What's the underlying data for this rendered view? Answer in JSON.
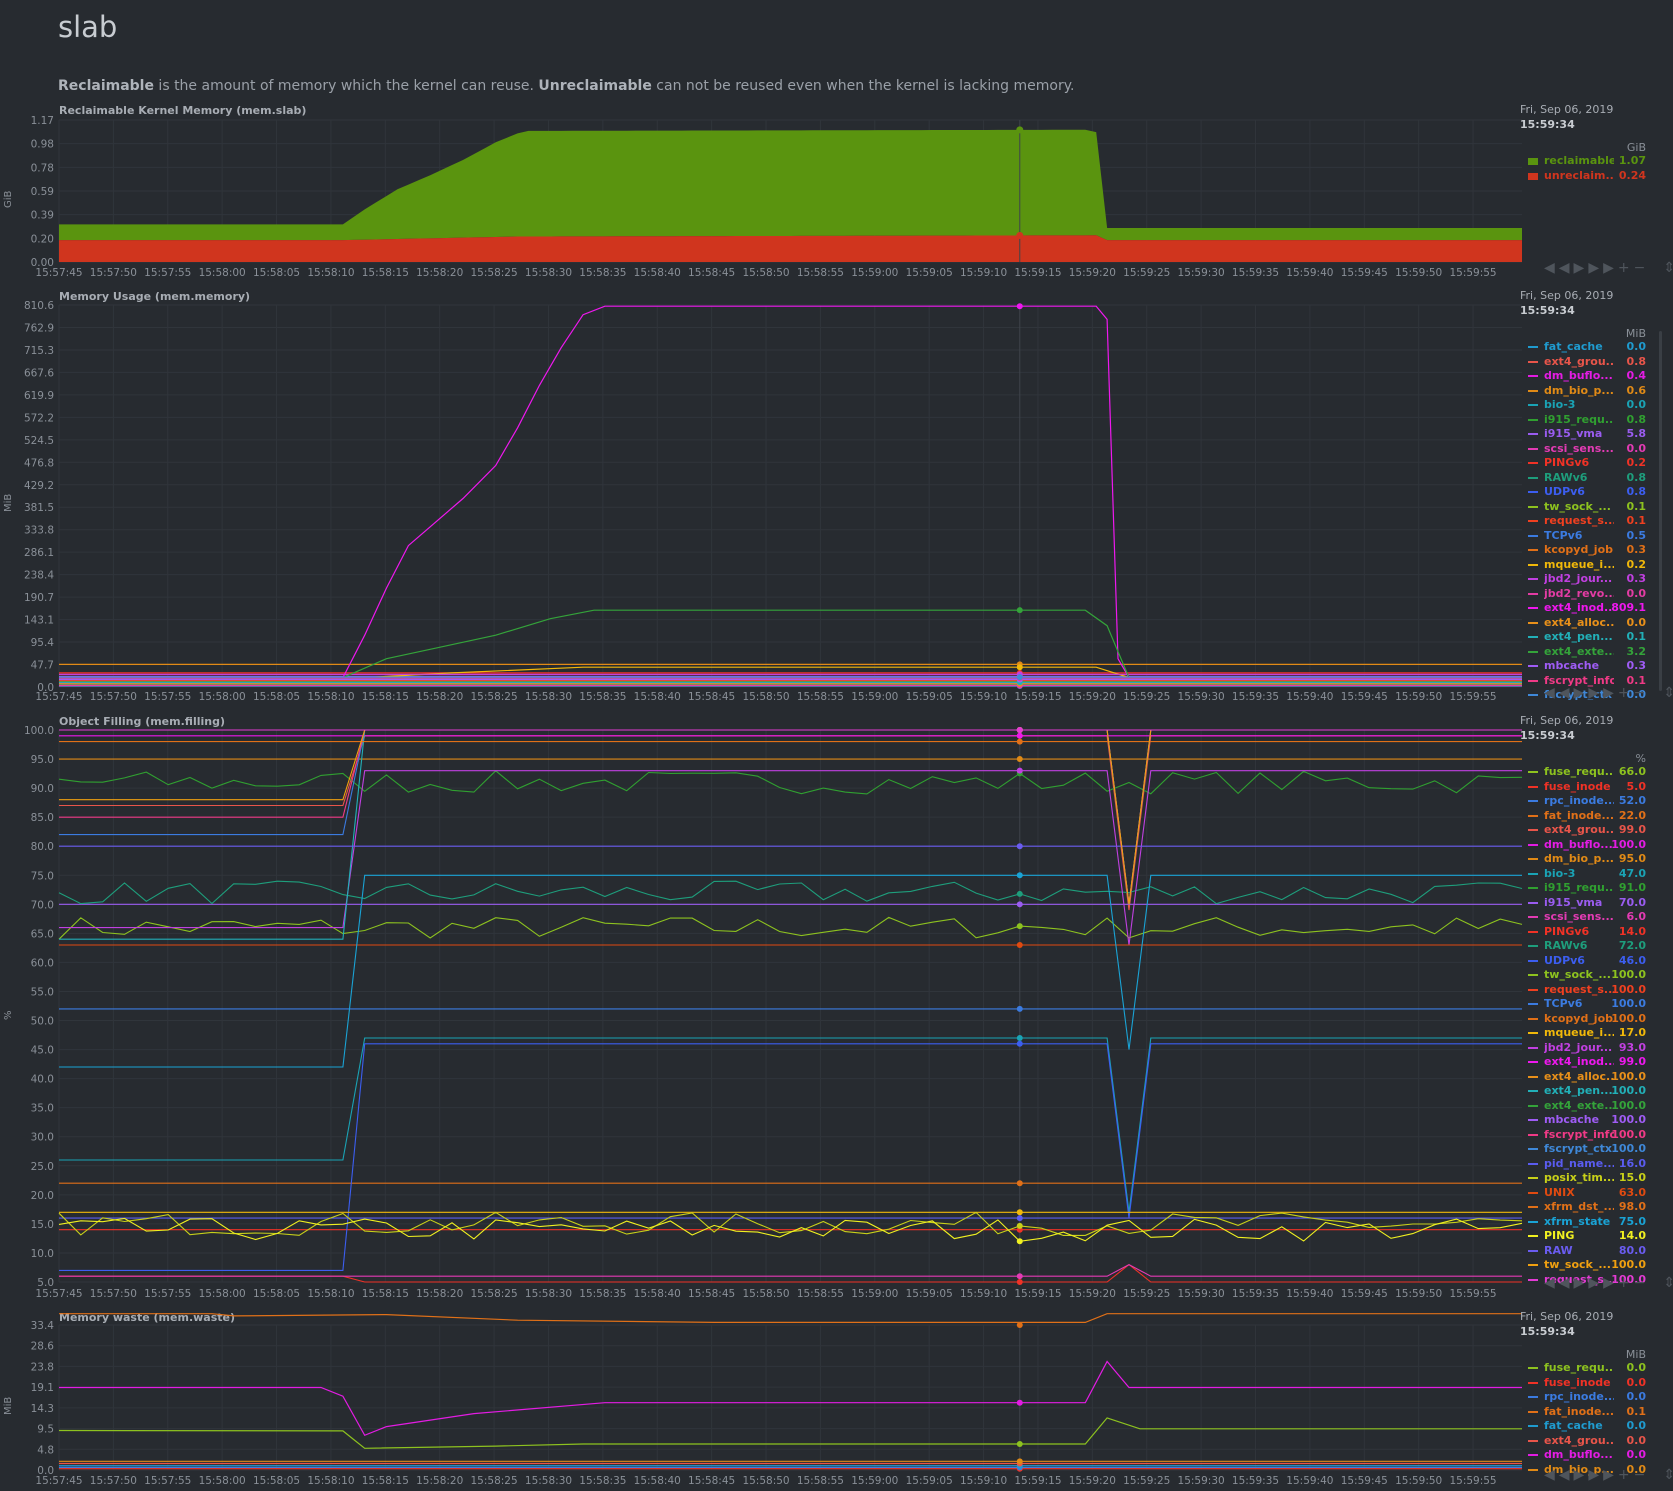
{
  "page": {
    "title": "slab",
    "description_bold1": "Reclaimable",
    "description_mid": " is the amount of memory which the kernel can reuse. ",
    "description_bold2": "Unreclaimable",
    "description_tail": " can not be reused even when the kernel is lacking memory."
  },
  "legend_date": "Fri, Sep 06, 2019",
  "legend_time": "15:59:34",
  "toolbar": [
    "◀◀",
    "▶",
    "▶▶",
    "+",
    "−",
    "⇕"
  ],
  "colors": {
    "background": "#272b30",
    "grid": "#30353b",
    "axis_text": "#8a9098",
    "green_area": "#5a940f",
    "red_area": "#d0351e"
  },
  "chart_data": [
    {
      "id": "mem.slab",
      "type": "area",
      "title": "Reclaimable Kernel Memory (mem.slab)",
      "unit": "GiB",
      "x": [
        "15:57:45",
        "15:57:50",
        "15:57:55",
        "15:58:00",
        "15:58:05",
        "15:58:10",
        "15:58:15",
        "15:58:20",
        "15:58:25",
        "15:58:30",
        "15:58:35",
        "15:58:40",
        "15:58:45",
        "15:58:50",
        "15:58:55",
        "15:59:00",
        "15:59:05",
        "15:59:10",
        "15:59:15",
        "15:59:20",
        "15:59:25",
        "15:59:30",
        "15:59:35",
        "15:59:40",
        "15:59:45",
        "15:59:50",
        "15:59:55"
      ],
      "yticks": [
        "1.17",
        "0.98",
        "0.78",
        "0.59",
        "0.39",
        "0.20",
        "0.00"
      ],
      "ylim": [
        0,
        1.17
      ],
      "series": [
        {
          "name": "reclaimable",
          "color": "#5a940f",
          "legend_value": "1.07",
          "points": [
            [
              0,
              0.13
            ],
            [
              26,
              0.13
            ],
            [
              28,
              0.25
            ],
            [
              31,
              0.41
            ],
            [
              34,
              0.52
            ],
            [
              37,
              0.64
            ],
            [
              40,
              0.78
            ],
            [
              42,
              0.85
            ],
            [
              43,
              0.87
            ],
            [
              94,
              0.87
            ],
            [
              95,
              0.85
            ],
            [
              96,
              0.1
            ],
            [
              134,
              0.1
            ]
          ]
        },
        {
          "name": "unreclaim...",
          "color": "#d0351e",
          "legend_value": "0.24",
          "points": [
            [
              0,
              0.18
            ],
            [
              26,
              0.18
            ],
            [
              42,
              0.21
            ],
            [
              95,
              0.22
            ],
            [
              96,
              0.18
            ],
            [
              134,
              0.18
            ]
          ]
        }
      ]
    },
    {
      "id": "mem.memory",
      "type": "line",
      "title": "Memory Usage (mem.memory)",
      "unit": "MiB",
      "yticks": [
        "810.6",
        "762.9",
        "715.3",
        "667.6",
        "619.9",
        "572.2",
        "524.5",
        "476.8",
        "429.2",
        "381.5",
        "333.8",
        "286.1",
        "238.4",
        "190.7",
        "143.1",
        "95.4",
        "47.7",
        "0.0"
      ],
      "ylim": [
        0,
        810.6
      ],
      "legend": [
        {
          "name": "fat_cache",
          "value": "0.0",
          "color": "#1f9bcf"
        },
        {
          "name": "ext4_grou...",
          "value": "0.8",
          "color": "#e8554a"
        },
        {
          "name": "dm_buflo...",
          "value": "0.4",
          "color": "#e31ce3"
        },
        {
          "name": "dm_bio_p...",
          "value": "0.6",
          "color": "#e08a16"
        },
        {
          "name": "bio-3",
          "value": "0.0",
          "color": "#1aa3b5"
        },
        {
          "name": "i915_requ...",
          "value": "0.8",
          "color": "#30a030"
        },
        {
          "name": "i915_vma",
          "value": "5.8",
          "color": "#9a5cf0"
        },
        {
          "name": "scsi_sens...",
          "value": "0.0",
          "color": "#e33bb4"
        },
        {
          "name": "PINGv6",
          "value": "0.2",
          "color": "#f03226"
        },
        {
          "name": "RAWv6",
          "value": "0.8",
          "color": "#1e9e7c"
        },
        {
          "name": "UDPv6",
          "value": "0.8",
          "color": "#3c5ef0"
        },
        {
          "name": "tw_sock_...",
          "value": "0.1",
          "color": "#8dc21f"
        },
        {
          "name": "request_s...",
          "value": "0.1",
          "color": "#f04020"
        },
        {
          "name": "TCPv6",
          "value": "0.5",
          "color": "#3b7be0"
        },
        {
          "name": "kcopyd_job",
          "value": "0.3",
          "color": "#e07018"
        },
        {
          "name": "mqueue_i...",
          "value": "0.2",
          "color": "#f0b80a"
        },
        {
          "name": "jbd2_jour...",
          "value": "0.3",
          "color": "#c040e0"
        },
        {
          "name": "jbd2_revo...",
          "value": "0.0",
          "color": "#e33ca4"
        },
        {
          "name": "ext4_inod...",
          "value": "809.1",
          "color": "#ee18ee"
        },
        {
          "name": "ext4_alloc...",
          "value": "0.0",
          "color": "#e8901a"
        },
        {
          "name": "ext4_pen...",
          "value": "0.1",
          "color": "#22b0b8"
        },
        {
          "name": "ext4_exte...",
          "value": "3.2",
          "color": "#34a33a"
        },
        {
          "name": "mbcache",
          "value": "0.3",
          "color": "#9f5cf5"
        },
        {
          "name": "fscrypt_info",
          "value": "0.1",
          "color": "#f03a86"
        },
        {
          "name": "fscrypt_ctx",
          "value": "0.0",
          "color": "#3f88d8"
        }
      ]
    },
    {
      "id": "mem.filling",
      "type": "line",
      "title": "Object Filling (mem.filling)",
      "unit": "%",
      "yticks": [
        "100.0",
        "95.0",
        "90.0",
        "85.0",
        "80.0",
        "75.0",
        "70.0",
        "65.0",
        "60.0",
        "55.0",
        "50.0",
        "45.0",
        "40.0",
        "35.0",
        "30.0",
        "25.0",
        "20.0",
        "15.0",
        "10.0",
        "5.0"
      ],
      "ylim": [
        5,
        100
      ],
      "legend": [
        {
          "name": "fuse_requ...",
          "value": "66.0",
          "color": "#8dc21f"
        },
        {
          "name": "fuse_inode",
          "value": "5.0",
          "color": "#f03226"
        },
        {
          "name": "rpc_inode...",
          "value": "52.0",
          "color": "#3b7be0"
        },
        {
          "name": "fat_inode...",
          "value": "22.0",
          "color": "#e07018"
        },
        {
          "name": "ext4_grou...",
          "value": "99.0",
          "color": "#e8554a"
        },
        {
          "name": "dm_buflo...",
          "value": "100.0",
          "color": "#e31ce3"
        },
        {
          "name": "dm_bio_p...",
          "value": "95.0",
          "color": "#e08a16"
        },
        {
          "name": "bio-3",
          "value": "47.0",
          "color": "#1aa3b5"
        },
        {
          "name": "i915_requ...",
          "value": "91.0",
          "color": "#30a030"
        },
        {
          "name": "i915_vma",
          "value": "70.0",
          "color": "#9a5cf0"
        },
        {
          "name": "scsi_sens...",
          "value": "6.0",
          "color": "#e33bb4"
        },
        {
          "name": "PINGv6",
          "value": "14.0",
          "color": "#f03226"
        },
        {
          "name": "RAWv6",
          "value": "72.0",
          "color": "#1e9e7c"
        },
        {
          "name": "UDPv6",
          "value": "46.0",
          "color": "#3c5ef0"
        },
        {
          "name": "tw_sock_...",
          "value": "100.0",
          "color": "#8dc21f"
        },
        {
          "name": "request_s...",
          "value": "100.0",
          "color": "#f04020"
        },
        {
          "name": "TCPv6",
          "value": "100.0",
          "color": "#3b7be0"
        },
        {
          "name": "kcopyd_job",
          "value": "100.0",
          "color": "#e07018"
        },
        {
          "name": "mqueue_i...",
          "value": "17.0",
          "color": "#f0b80a"
        },
        {
          "name": "jbd2_jour...",
          "value": "93.0",
          "color": "#c040e0"
        },
        {
          "name": "ext4_inod...",
          "value": "99.0",
          "color": "#ee18ee"
        },
        {
          "name": "ext4_alloc...",
          "value": "100.0",
          "color": "#e8901a"
        },
        {
          "name": "ext4_pen...",
          "value": "100.0",
          "color": "#22b0b8"
        },
        {
          "name": "ext4_exte...",
          "value": "100.0",
          "color": "#34a33a"
        },
        {
          "name": "mbcache",
          "value": "100.0",
          "color": "#9f5cf5"
        },
        {
          "name": "fscrypt_info",
          "value": "100.0",
          "color": "#f03a86"
        },
        {
          "name": "fscrypt_ctx",
          "value": "100.0",
          "color": "#3f88d8"
        },
        {
          "name": "pid_name...",
          "value": "16.0",
          "color": "#5a5cf0"
        },
        {
          "name": "posix_tim...",
          "value": "15.0",
          "color": "#c8d019"
        },
        {
          "name": "UNIX",
          "value": "63.0",
          "color": "#e04a10"
        },
        {
          "name": "xfrm_dst_...",
          "value": "98.0",
          "color": "#e07018"
        },
        {
          "name": "xfrm_state",
          "value": "75.0",
          "color": "#1aa3d5"
        },
        {
          "name": "PING",
          "value": "14.0",
          "color": "#f0f020"
        },
        {
          "name": "RAW",
          "value": "80.0",
          "color": "#6a5cf0"
        },
        {
          "name": "tw_sock_...",
          "value": "100.0",
          "color": "#f0a010"
        },
        {
          "name": "request_s...",
          "value": "100.0",
          "color": "#e33bd4"
        }
      ]
    },
    {
      "id": "mem.waste",
      "type": "line",
      "title": "Memory waste (mem.waste)",
      "unit": "MiB",
      "yticks": [
        "33.4",
        "28.6",
        "23.8",
        "19.1",
        "14.3",
        "9.5",
        "4.8",
        "0.0"
      ],
      "ylim": [
        0,
        33.4
      ],
      "legend": [
        {
          "name": "fuse_requ...",
          "value": "0.0",
          "color": "#8dc21f"
        },
        {
          "name": "fuse_inode",
          "value": "0.0",
          "color": "#f03226"
        },
        {
          "name": "rpc_inode...",
          "value": "0.0",
          "color": "#3b7be0"
        },
        {
          "name": "fat_inode...",
          "value": "0.1",
          "color": "#e07018"
        },
        {
          "name": "fat_cache",
          "value": "0.0",
          "color": "#1f9bcf"
        },
        {
          "name": "ext4_grou...",
          "value": "0.0",
          "color": "#e8554a"
        },
        {
          "name": "dm_buflo...",
          "value": "0.0",
          "color": "#e31ce3"
        },
        {
          "name": "dm_bio_p...",
          "value": "0.0",
          "color": "#e08a16"
        }
      ]
    }
  ]
}
